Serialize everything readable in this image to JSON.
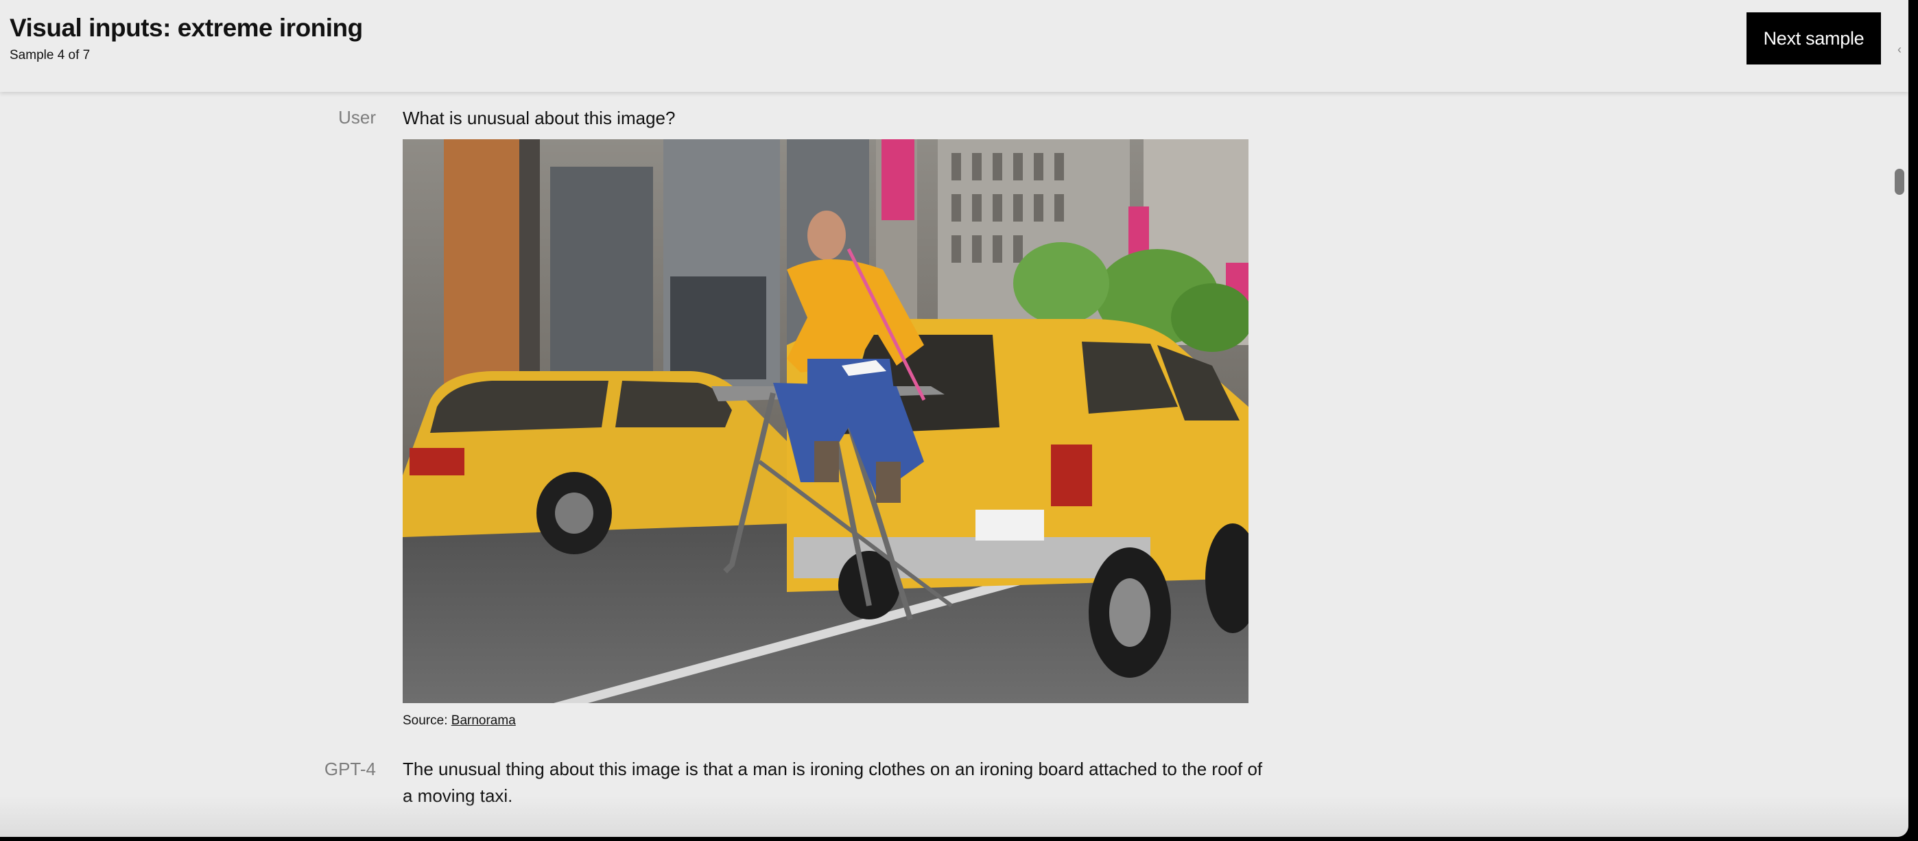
{
  "header": {
    "title": "Visual inputs: extreme ironing",
    "subtitle": "Sample 4 of 7",
    "next_label": "Next sample"
  },
  "conversation": {
    "user": {
      "role": "User",
      "text": "What is unusual about this image?"
    },
    "source": {
      "prefix": "Source: ",
      "link_text": "Barnorama"
    },
    "assistant": {
      "role": "GPT-4",
      "text": "The unusual thing about this image is that a man is ironing clothes on an ironing board attached to the roof of a moving taxi."
    }
  },
  "photo": {
    "subject": "man ironing clothes on an ironing board attached to the back of a yellow taxi on a city street"
  },
  "colors": {
    "background": "#ececec",
    "button_bg": "#000000",
    "button_text": "#ffffff",
    "role_text": "#7d7d7d",
    "body_text": "#111111",
    "taxi_yellow": "#e9b52a"
  },
  "icons": {
    "edge_glyph": "partial-icon"
  }
}
